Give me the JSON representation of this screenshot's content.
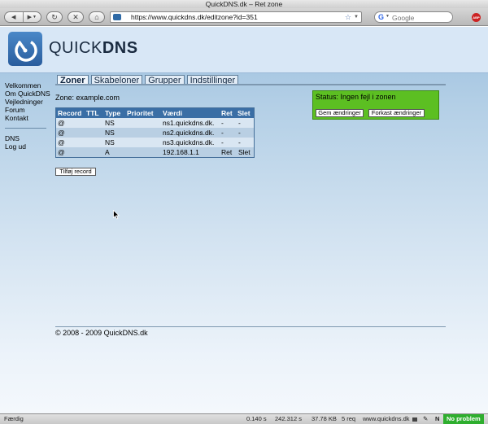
{
  "window": {
    "title": "QuickDNS.dk – Ret zone"
  },
  "toolbar": {
    "back_icon": "◀",
    "forward_icon": "▶",
    "reload_icon": "↻",
    "stop_icon": "✕",
    "home_icon": "⌂",
    "url": "https://www.quickdns.dk/editzone?id=351",
    "bookmark_star": "☆",
    "search_placeholder": "Google",
    "adblock_label": "ABP"
  },
  "header": {
    "logo_text_light": "QUICK",
    "logo_text_bold": "DNS"
  },
  "sidebar": {
    "items": [
      "Velkommen",
      "Om QuickDNS",
      "Vejledninger",
      "Forum",
      "Kontakt"
    ],
    "items2": [
      "DNS",
      "Log ud"
    ]
  },
  "tabs": [
    "Zoner",
    "Skabeloner",
    "Grupper",
    "Indstillinger"
  ],
  "zone": {
    "label": "Zone: example.com"
  },
  "records": {
    "headers": [
      "Record",
      "TTL",
      "Type",
      "Prioritet",
      "Værdi",
      "Ret",
      "Slet"
    ],
    "rows": [
      [
        "@",
        "",
        "NS",
        "",
        "ns1.quickdns.dk.",
        "-",
        "-"
      ],
      [
        "@",
        "",
        "NS",
        "",
        "ns2.quickdns.dk.",
        "-",
        "-"
      ],
      [
        "@",
        "",
        "NS",
        "",
        "ns3.quickdns.dk.",
        "-",
        "-"
      ],
      [
        "@",
        "",
        "A",
        "",
        "192.168.1.1",
        "Ret",
        "Slet"
      ]
    ],
    "add_button": "Tilføj record"
  },
  "status_box": {
    "text": "Status: Ingen fejl i zonen",
    "save_button": "Gem ændringer",
    "discard_button": "Forkast ændringer",
    "color": "#5cbf22"
  },
  "footer": {
    "text": "© 2008 - 2009 QuickDNS.dk"
  },
  "statusbar": {
    "status": "Færdig",
    "time": "0.140 s",
    "time2": "242.312 s",
    "size": "37.78 KB",
    "requests": "5 req",
    "domain": "www.quickdns.dk",
    "np_label": "No problem"
  }
}
